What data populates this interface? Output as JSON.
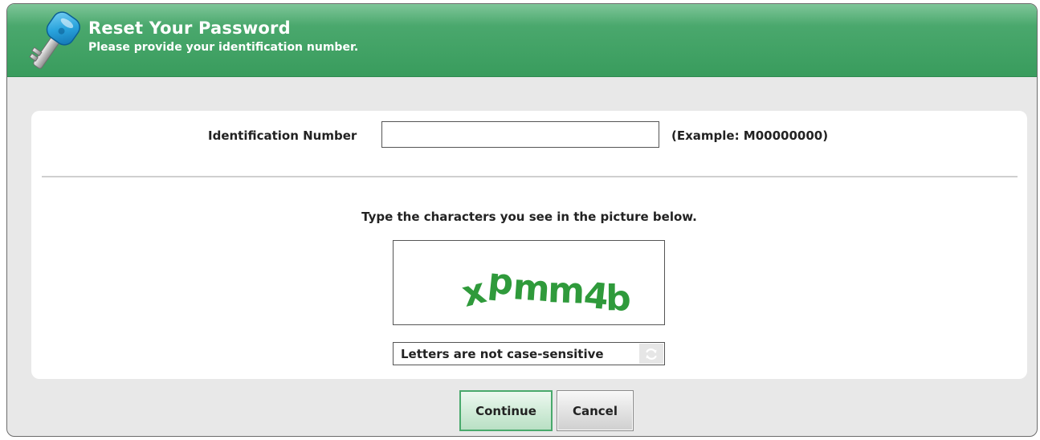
{
  "header": {
    "title": "Reset Your Password",
    "subtitle": "Please provide your identification number.",
    "icon": "key-icon",
    "color": "#3d9e60"
  },
  "identification": {
    "label": "Identification Number",
    "value": "",
    "example": "(Example: M00000000)"
  },
  "captcha": {
    "prompt": "Type the characters you see in the picture below.",
    "image_text": "xpmm4b",
    "image_color": "#2f9a3b",
    "input_placeholder": "Letters are not case-sensitive",
    "refresh_icon": "refresh-icon"
  },
  "buttons": {
    "continue_label": "Continue",
    "cancel_label": "Cancel"
  }
}
